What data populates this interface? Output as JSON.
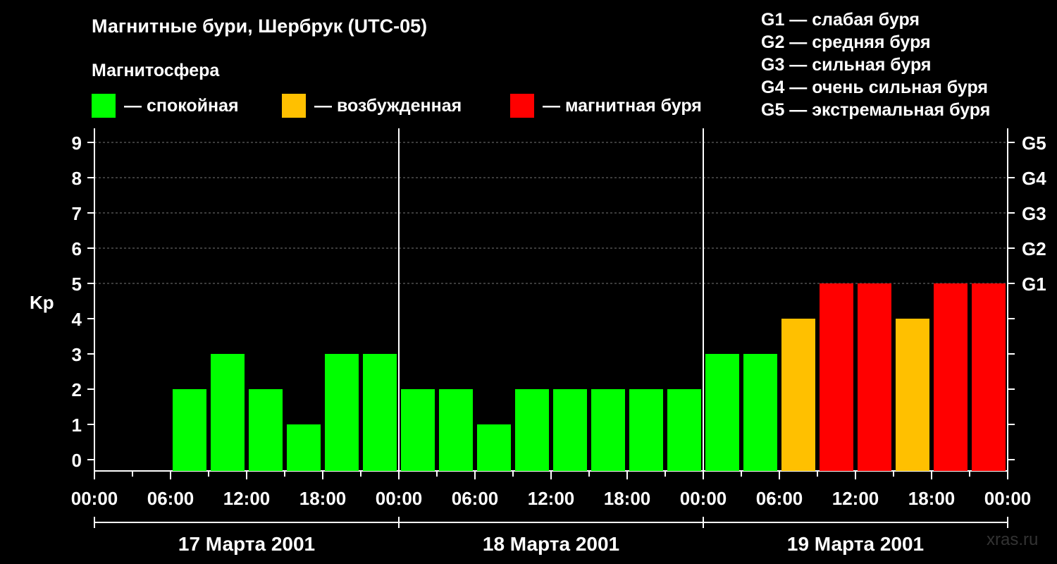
{
  "title": "Магнитные бури, Шербрук (UTC-05)",
  "subtitle": "Магнитосфера",
  "legend": [
    {
      "label": "— спокойная",
      "color": "#00ff00"
    },
    {
      "label": "— возбужденная",
      "color": "#ffc000"
    },
    {
      "label": "— магнитная буря",
      "color": "#ff0000"
    }
  ],
  "g_legend": [
    "G1 — слабая буря",
    "G2 — средняя буря",
    "G3 — сильная буря",
    "G4 — очень сильная буря",
    "G5 — экстремальная буря"
  ],
  "watermark": "xras.ru",
  "chart_data": {
    "type": "bar",
    "ylabel": "Kp",
    "ylim": [
      0,
      9
    ],
    "y_ticks": [
      "0",
      "1",
      "2",
      "3",
      "4",
      "5",
      "6",
      "7",
      "8",
      "9"
    ],
    "g_levels": [
      {
        "label": "G1",
        "kp": 5
      },
      {
        "label": "G2",
        "kp": 6
      },
      {
        "label": "G3",
        "kp": 7
      },
      {
        "label": "G4",
        "kp": 8
      },
      {
        "label": "G5",
        "kp": 9
      }
    ],
    "x_tick_labels": [
      "00:00",
      "06:00",
      "12:00",
      "18:00",
      "00:00",
      "06:00",
      "12:00",
      "18:00",
      "00:00",
      "06:00",
      "12:00",
      "18:00",
      "00:00"
    ],
    "day_labels": [
      "17 Марта 2001",
      "18 Марта 2001",
      "19 Марта 2001"
    ],
    "interval_hours": 3,
    "values": [
      null,
      null,
      2,
      3,
      2,
      1,
      3,
      3,
      2,
      2,
      1,
      2,
      2,
      2,
      2,
      2,
      3,
      3,
      4,
      5,
      5,
      4,
      5,
      5
    ],
    "colors": {
      "quiet": "#00ff00",
      "active": "#ffc000",
      "storm": "#ff0000"
    },
    "thresholds": {
      "active": 4,
      "storm": 5
    },
    "grid": true
  }
}
